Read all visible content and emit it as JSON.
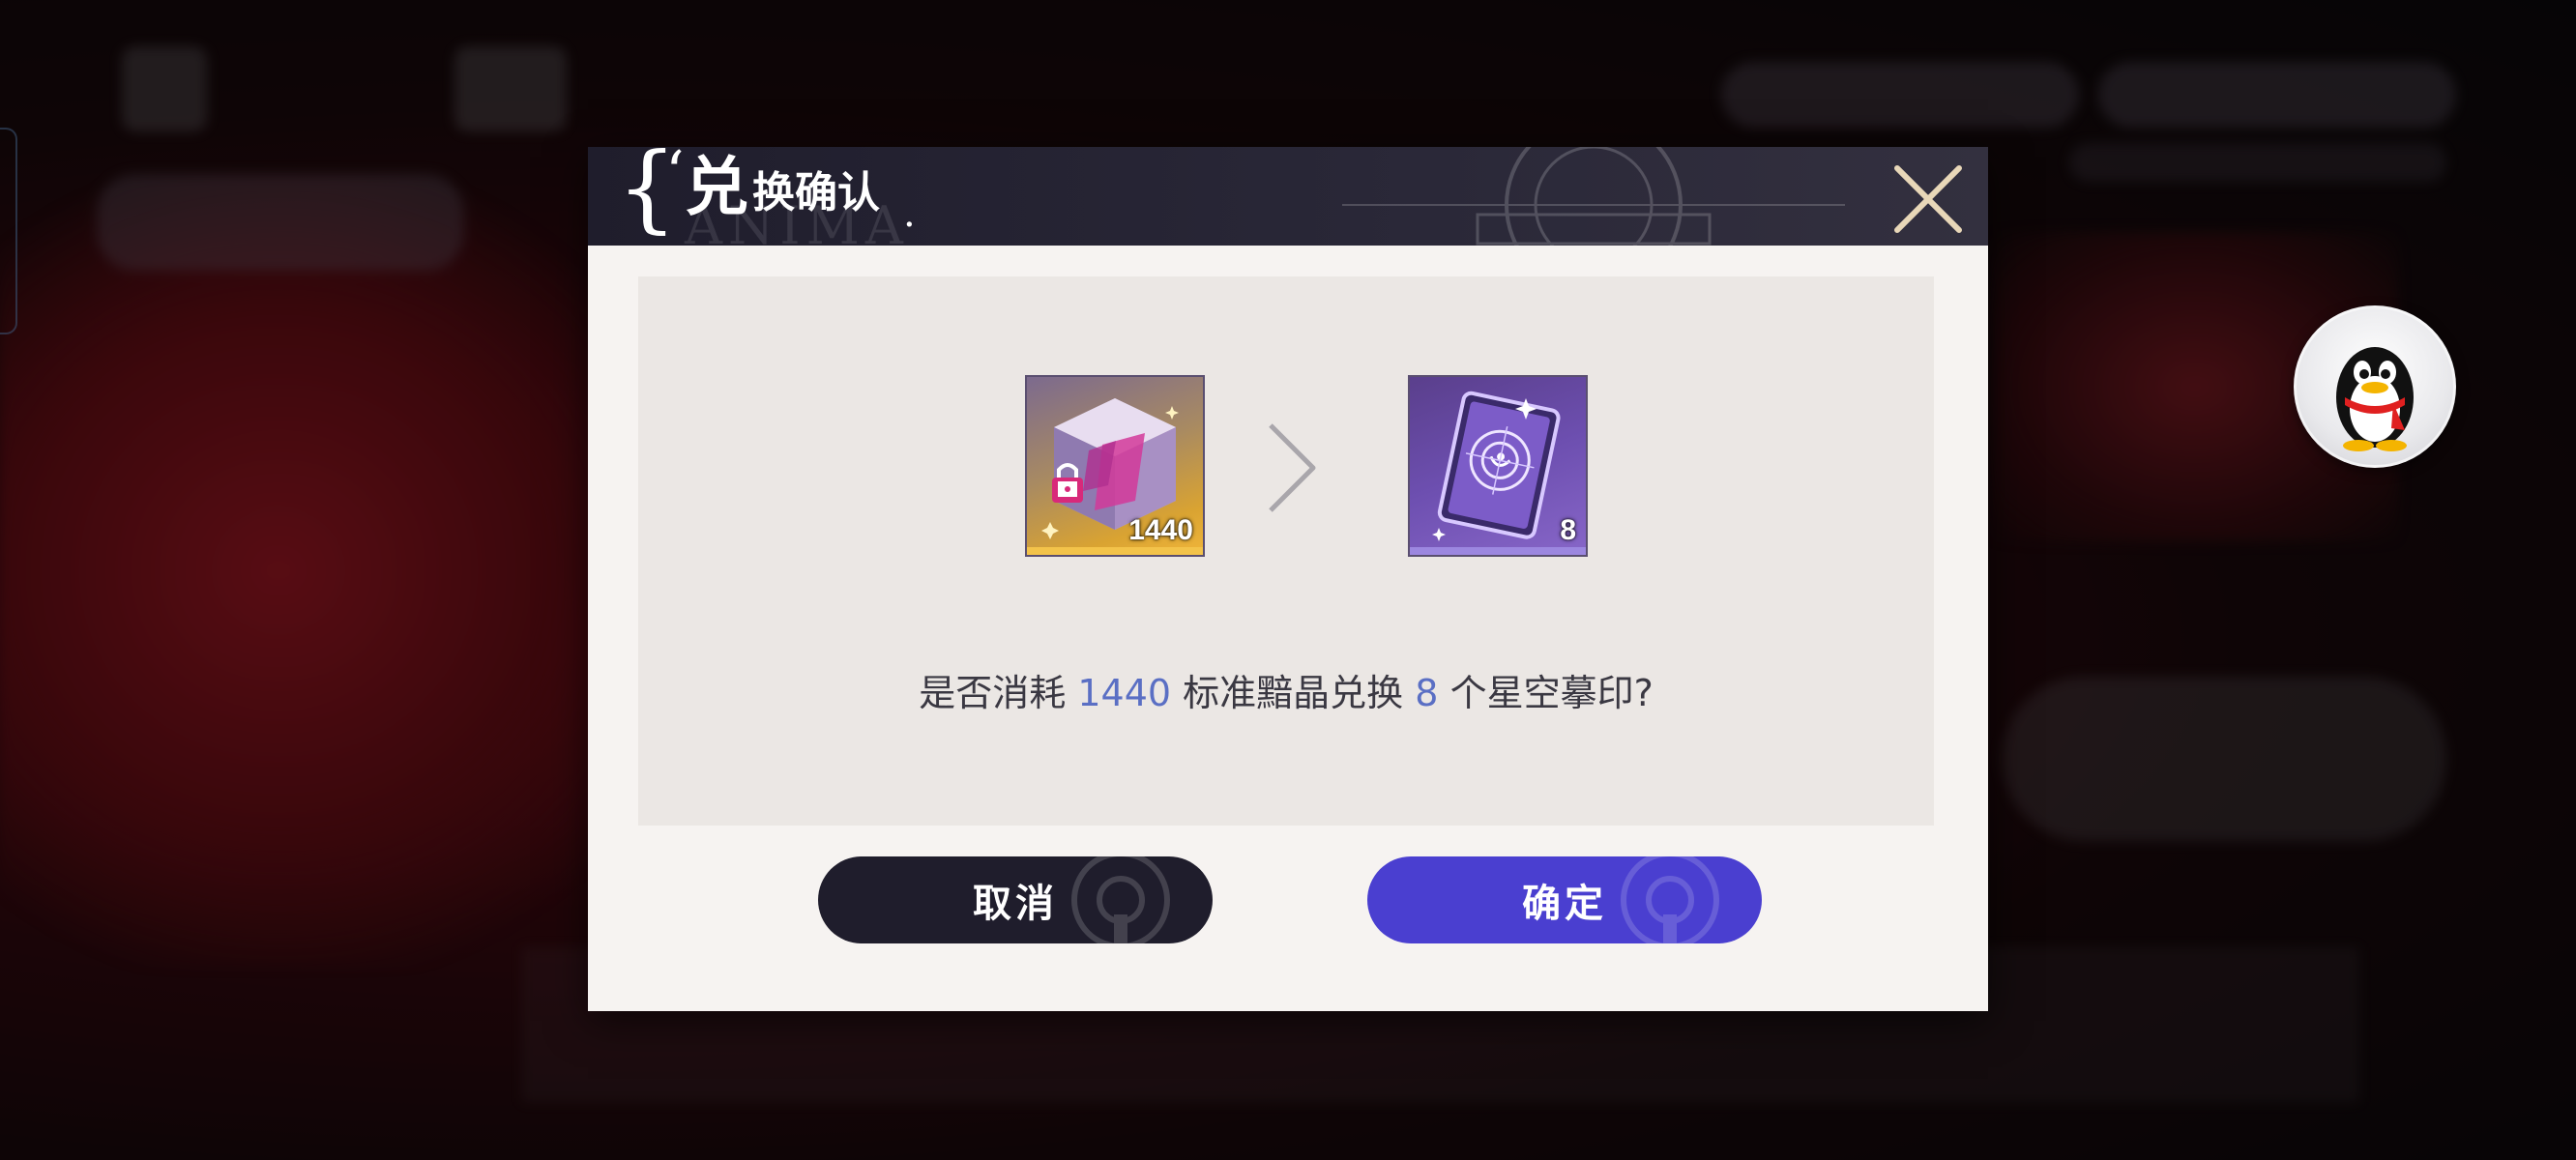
{
  "dialog": {
    "title_first_char": "兑",
    "title_rest": "换确认",
    "title_watermark": "ANIMA",
    "close_icon": "close-x-icon",
    "cost_item": {
      "icon": "locked-crystal-cube-icon",
      "count": "1440"
    },
    "reward_item": {
      "icon": "star-seal-card-icon",
      "count": "8"
    },
    "arrow_icon": "chevron-right-icon",
    "prompt": {
      "prefix": "是否消耗",
      "cost_amount": "1440",
      "middle": "标准黯晶兑换",
      "reward_amount": "8",
      "suffix": "个星空摹印?"
    },
    "cancel_label": "取消",
    "confirm_label": "确定"
  },
  "floating": {
    "qq_icon": "qq-penguin-icon"
  },
  "colors": {
    "header_bg": "#1f1d2c",
    "dialog_bg": "#f6f3f1",
    "body_bg": "#ebe7e4",
    "highlight": "#5a6fc4",
    "cancel_bg": "#1f1d2c",
    "confirm_bg": "#4a3fd0",
    "close_icon": "#e8d7b8"
  }
}
